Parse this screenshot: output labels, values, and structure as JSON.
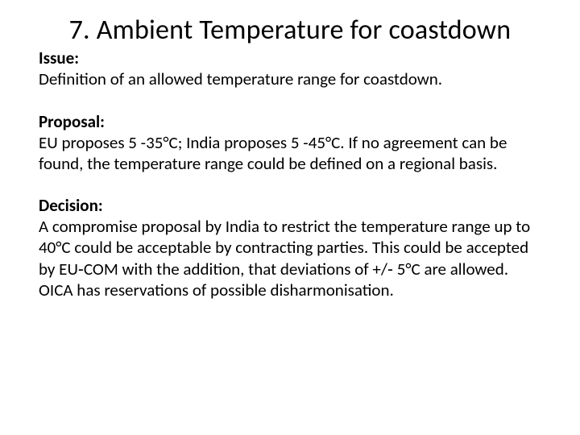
{
  "title": "7. Ambient Temperature for coastdown",
  "issue": {
    "label": "Issue:",
    "text": "Definition of an allowed temperature range for coastdown."
  },
  "proposal": {
    "label": "Proposal:",
    "text": "EU proposes 5 -35°C; India proposes 5 -45°C. If no agreement can be found, the temperature range could be defined on a regional basis."
  },
  "decision": {
    "label": "Decision:",
    "text": "A compromise proposal by India to restrict the temperature range up to 40°C could be acceptable by contracting parties. This could be accepted by EU‑COM with the addition, that deviations of  +/‑ 5°C are allowed. OICA has reservations of possible disharmonisation."
  }
}
